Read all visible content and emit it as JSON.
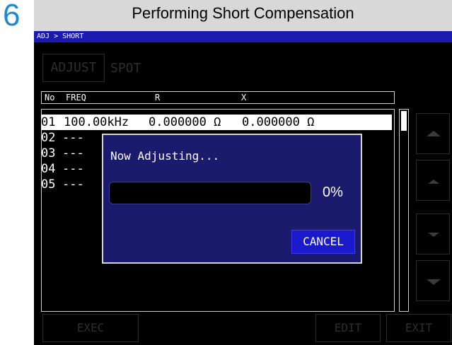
{
  "step_number": "6",
  "header": {
    "title": "Performing Short Compensation"
  },
  "screen": {
    "breadcrumb": "ADJ > SHORT",
    "buttons": {
      "adjust": "ADJUST",
      "spot": "SPOT",
      "exec": "EXEC",
      "edit": "EDIT",
      "exit": "EXIT"
    },
    "table": {
      "columns": [
        "No",
        "FREQ",
        "R",
        "X"
      ],
      "rows": [
        {
          "no": "01",
          "freq": "100.00kHz",
          "r": "0.000000 Ω",
          "x": "0.000000 Ω",
          "selected": true
        },
        {
          "no": "02",
          "freq": "---",
          "r": "",
          "x": ""
        },
        {
          "no": "03",
          "freq": "---",
          "r": "",
          "x": ""
        },
        {
          "no": "04",
          "freq": "---",
          "r": "",
          "x": ""
        },
        {
          "no": "05",
          "freq": "---",
          "r": "",
          "x": ""
        }
      ]
    },
    "side_buttons": [
      "page-up-icon",
      "scroll-up-icon",
      "scroll-down-icon",
      "page-down-icon"
    ],
    "dialog": {
      "message": "Now Adjusting...",
      "progress_percent": 0,
      "progress_label": "0%",
      "cancel_label": "CANCEL"
    }
  },
  "colors": {
    "step_number": "#1e88d8",
    "breadcrumb_bar": "#1a1ab0",
    "dialog_bg": "#1b1b6e",
    "cancel_button": "#1a1acc"
  }
}
